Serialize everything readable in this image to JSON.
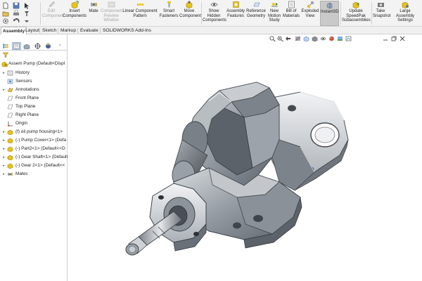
{
  "ribbon": {
    "commands": [
      {
        "label": "Edit\nComponent",
        "icon": "edit-component-icon",
        "enabled": false
      },
      {
        "label": "Insert\nComponents",
        "icon": "insert-components-icon",
        "enabled": true
      },
      {
        "label": "Mate",
        "icon": "mate-icon",
        "enabled": true
      },
      {
        "label": "Component\nPreview\nWindow",
        "icon": "component-preview-icon",
        "enabled": false
      },
      {
        "label": "Linear Component\nPattern",
        "icon": "linear-pattern-icon",
        "enabled": true
      },
      {
        "label": "Smart\nFasteners",
        "icon": "smart-fasteners-icon",
        "enabled": true
      },
      {
        "label": "Move\nComponent",
        "icon": "move-component-icon",
        "enabled": true
      },
      {
        "label": "Show\nHidden\nComponents",
        "icon": "show-hidden-icon",
        "enabled": true
      },
      {
        "label": "Assembly\nFeatures",
        "icon": "assembly-features-icon",
        "enabled": true
      },
      {
        "label": "Reference\nGeometry",
        "icon": "reference-geometry-icon",
        "enabled": true
      },
      {
        "label": "New\nMotion\nStudy",
        "icon": "motion-study-icon",
        "enabled": true
      },
      {
        "label": "Bill of\nMaterials",
        "icon": "bill-of-materials-icon",
        "enabled": true
      },
      {
        "label": "Exploded\nView",
        "icon": "exploded-view-icon",
        "enabled": true
      },
      {
        "label": "Instant3D",
        "icon": "instant3d-icon",
        "enabled": true,
        "active": true
      },
      {
        "label": "Update\nSpeedPak\nSubassemblies",
        "icon": "speedpak-icon",
        "enabled": true
      },
      {
        "label": "Take\nSnapshot",
        "icon": "snapshot-icon",
        "enabled": true
      },
      {
        "label": "Large\nAssembly\nSettings",
        "icon": "large-assembly-icon",
        "enabled": true
      }
    ]
  },
  "tabs": [
    "Assembly",
    "Layout",
    "Sketch",
    "Markup",
    "Evaluate",
    "SOLIDWORKS Add-Ins"
  ],
  "active_tab": "Assembly",
  "feature_tree": {
    "root": "Assem Pump  (Default<Displ",
    "items": [
      {
        "label": "History",
        "icon": "history-icon",
        "expander": "right"
      },
      {
        "label": "Sensors",
        "icon": "sensors-icon",
        "expander": ""
      },
      {
        "label": "Annotations",
        "icon": "annotations-icon",
        "expander": "right"
      },
      {
        "label": "Front Plane",
        "icon": "plane-icon",
        "expander": ""
      },
      {
        "label": "Top Plane",
        "icon": "plane-icon",
        "expander": ""
      },
      {
        "label": "Right Plane",
        "icon": "plane-icon",
        "expander": ""
      },
      {
        "label": "Origin",
        "icon": "origin-icon",
        "expander": ""
      },
      {
        "label": "(f) oil pump housing<1>",
        "icon": "part-icon",
        "expander": "right"
      },
      {
        "label": "(-) Pump Cover<1> (Defa",
        "icon": "part-icon",
        "expander": "right"
      },
      {
        "label": "(-) Part2<1> (Default<<D",
        "icon": "part-icon",
        "expander": "right"
      },
      {
        "label": "(-) Gear Shaft<1> (Default",
        "icon": "part-icon",
        "expander": "right"
      },
      {
        "label": "(-) Gear 2<1> (Default<<",
        "icon": "part-icon",
        "expander": "right"
      },
      {
        "label": "Mates",
        "icon": "mates-icon",
        "expander": "right"
      }
    ]
  },
  "colors": {
    "ribbon_bg": "#f3f3f3",
    "part_icon": "#e8c31a",
    "active_tab_border": "#9ab3d6",
    "model_metal": "#8f959c"
  }
}
